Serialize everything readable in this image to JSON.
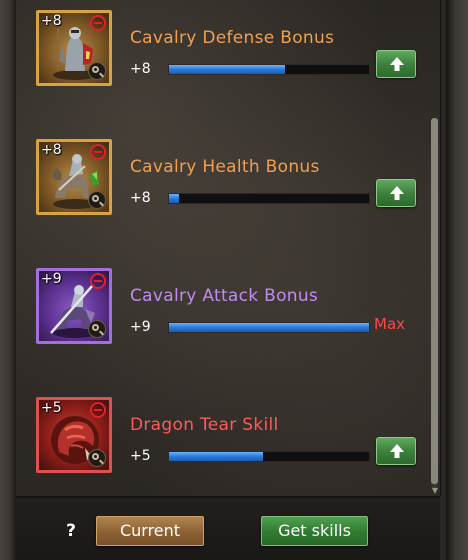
{
  "skills": [
    {
      "name": "Cavalry Defense Bonus",
      "icon": "cavalry-defense-icon",
      "level": "+8",
      "value": "+8",
      "progress_fraction": 0.58,
      "rarity": "gold",
      "action": "upgrade",
      "max_label": ""
    },
    {
      "name": "Cavalry Health Bonus",
      "icon": "cavalry-health-icon",
      "level": "+8",
      "value": "+8",
      "progress_fraction": 0.05,
      "rarity": "gold",
      "action": "upgrade",
      "max_label": ""
    },
    {
      "name": "Cavalry Attack Bonus",
      "icon": "cavalry-attack-icon",
      "level": "+9",
      "value": "+9",
      "progress_fraction": 1.0,
      "rarity": "purple",
      "action": "max",
      "max_label": "Max"
    },
    {
      "name": "Dragon Tear Skill",
      "icon": "dragon-tear-icon",
      "level": "+5",
      "value": "+5",
      "progress_fraction": 0.47,
      "rarity": "red",
      "action": "upgrade",
      "max_label": ""
    }
  ],
  "footer": {
    "help_label": "?",
    "current_label": "Current",
    "get_skills_label": "Get skills"
  },
  "colors": {
    "gold_text": "#f0a050",
    "purple_text": "#c08cf0",
    "red_text": "#ff5a58",
    "bar_fill": "#2b7ad8",
    "upgrade_green": "#3b7e3a",
    "max_red": "#ff4848"
  }
}
